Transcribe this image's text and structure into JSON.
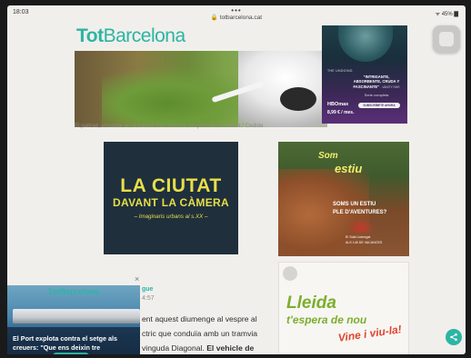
{
  "status_bar": {
    "time": "18:03",
    "url_dots": "•••",
    "url": "🔒 totbarcelona.cat",
    "battery": "ᯤ 45% ▇"
  },
  "site": {
    "logo_bold": "Tot",
    "logo_rest": "Barcelona",
    "brand_color": "#2cb5a3"
  },
  "hero": {
    "caption": "El patinet, encastat en la cabina d'un tramvia després de l'accident / Cedida"
  },
  "ads": {
    "hbo": {
      "show": "THE UNDOING",
      "quote": "\"INTRIGANTE, ABSORBENTE, CRUDA Y FASCINANTE\"",
      "quote_source": "- VANITY FAIR",
      "series_label": "Serie completa",
      "logo": "HBOmax",
      "cta": "SUBSCRÍBETE AHORA",
      "price": "8,99 € / mes."
    },
    "ciutat": {
      "title": "LA CIUTAT",
      "subtitle": "DAVANT LA CÀMERA",
      "tagline": "– Imaginaris urbans al s.XX –"
    },
    "estiu": {
      "logo_top": "Som",
      "logo_bottom": "estiu",
      "question_1": "SOMS UN ESTIU",
      "question_2": "PLE D'AVENTURES?",
      "footer_1": "El Solà Llobregat",
      "footer_2": "ALS 145 DE VACANCES"
    },
    "lleida": {
      "line_1": "Lleida",
      "line_2": "t'espera de nou",
      "line_3": "Vine i viu-la!"
    }
  },
  "article": {
    "close_label": "×",
    "author": "gue",
    "date": "4:57",
    "line_1": "ent aquest diumenge al vespre al",
    "line_2": "ctric que conduïa amb un tramvia",
    "line_3_prefix": "vinguda Diagonal. ",
    "line_3_bold": "El vehicle de"
  },
  "pip_video": {
    "header": "TotBarcelona",
    "title_1": "El Port explota contra el setge als",
    "title_2": "creuers: \"Que ens deixin tre"
  },
  "share": {
    "icon": "share-icon"
  }
}
